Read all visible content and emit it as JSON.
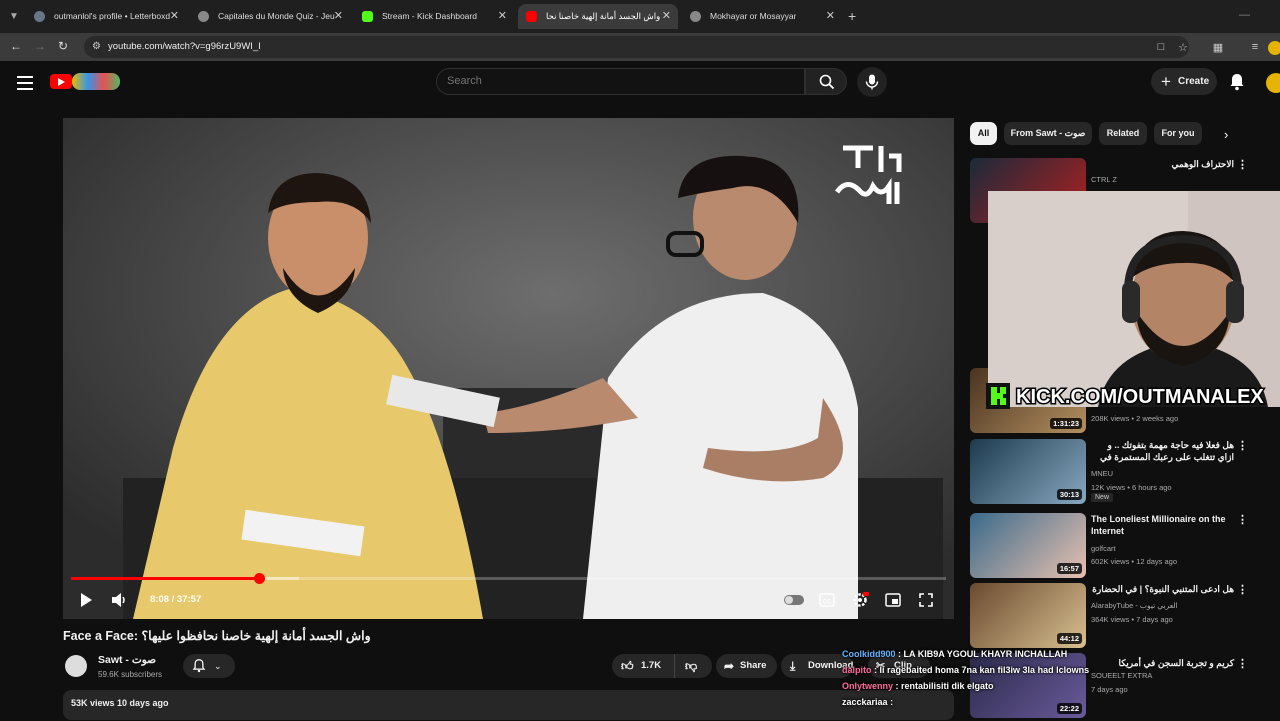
{
  "browser": {
    "tabs": [
      {
        "title": "outmanlol's profile • Letterboxd",
        "favicon_color": "#667788"
      },
      {
        "title": "Capitales du Monde Quiz - Jeu",
        "favicon_color": "#888888"
      },
      {
        "title": "Stream - Kick Dashboard",
        "favicon_color": "#53fc18"
      },
      {
        "title": "واش الجسد أمانة إلهية خاصنا نحا",
        "favicon_color": "#ff0000"
      },
      {
        "title": "Mokhayar or Mosayyar",
        "favicon_color": "#888888"
      }
    ],
    "active_tab_index": 3,
    "url": "youtube.com/watch?v=g96rzU9WI_I"
  },
  "youtube": {
    "search_placeholder": "Search",
    "create_label": "Create"
  },
  "player": {
    "current_time": "8:08",
    "total_time": "37:57",
    "time_display": "8:08 / 37:57",
    "progress_fraction": 0.2143,
    "buffered_fraction": 0.26
  },
  "video": {
    "title": "Face a Face: واش الجسد أمانة إلهية خاصنا نحافظوا عليها؟",
    "channel_name": "Sawt - صوت",
    "subscribers": "59.6K subscribers",
    "likes": "1.7K",
    "share_label": "Share",
    "download_label": "Download",
    "clip_label": "Clip",
    "views_date": "53K views  10 days ago"
  },
  "chips": [
    "All",
    "From Sawt - صوت",
    "Related",
    "For you"
  ],
  "recommendations": [
    {
      "title": "الاحتراف الوهمي",
      "channel": "CTRL Z",
      "meta": "",
      "duration": "",
      "thumb_colors": [
        "#1b2a3a",
        "#b02020"
      ]
    },
    {
      "title": "",
      "channel": "",
      "meta": "208K views • 2 weeks ago",
      "duration": "1:31:23",
      "thumb_colors": [
        "#4a3320",
        "#b39060"
      ]
    },
    {
      "title": "هل فعلا فيه حاجة مهمة بتفوتك .. و ازاي تتغلب على رعبك المستمرة في المنافسة ...",
      "channel": "MNEU",
      "meta": "12K views • 6 hours ago",
      "duration": "30:13",
      "badge": "New",
      "thumb_colors": [
        "#1d3a4e",
        "#88a8c0"
      ]
    },
    {
      "title": "The Loneliest Millionaire on the Internet",
      "channel": "golfcart",
      "meta": "602K views • 12 days ago",
      "duration": "16:57",
      "thumb_colors": [
        "#3a6a8a",
        "#e8c0b0"
      ]
    },
    {
      "title": "هل ادعى المتنبي النبوة؟ | في الحضارة",
      "channel": "AlarabyTube - العربي تيوب",
      "meta": "364K views • 7 days ago",
      "duration": "44:12",
      "thumb_colors": [
        "#6a4a30",
        "#d8c090"
      ]
    },
    {
      "title": "كريم و تجربة السجن في أمريكا",
      "channel": "SOUEELT EXTRA",
      "meta": "7 days ago",
      "duration": "22:22",
      "thumb_colors": [
        "#2a2a4a",
        "#6a5a9a"
      ]
    }
  ],
  "overlay": {
    "kick_url": "KICK.COM/OUTMANALEX",
    "chat": [
      {
        "user": "Coolkidd900",
        "text": ": LA KIB9A YGOUL KHAYR INCHALLAH",
        "color": "#64b3ff"
      },
      {
        "user": "dalpito",
        "text": ": li ragebaited homa 7na kan fil3iw 3la had lclowns",
        "color": "#ff6b9d"
      },
      {
        "user": "Onlytwenny",
        "text": ": rentabilisiti dik elgato",
        "color": "#ff6b9d"
      },
      {
        "user": "zaccka​riaa",
        "text": ":",
        "color": "#ffffff"
      }
    ]
  }
}
